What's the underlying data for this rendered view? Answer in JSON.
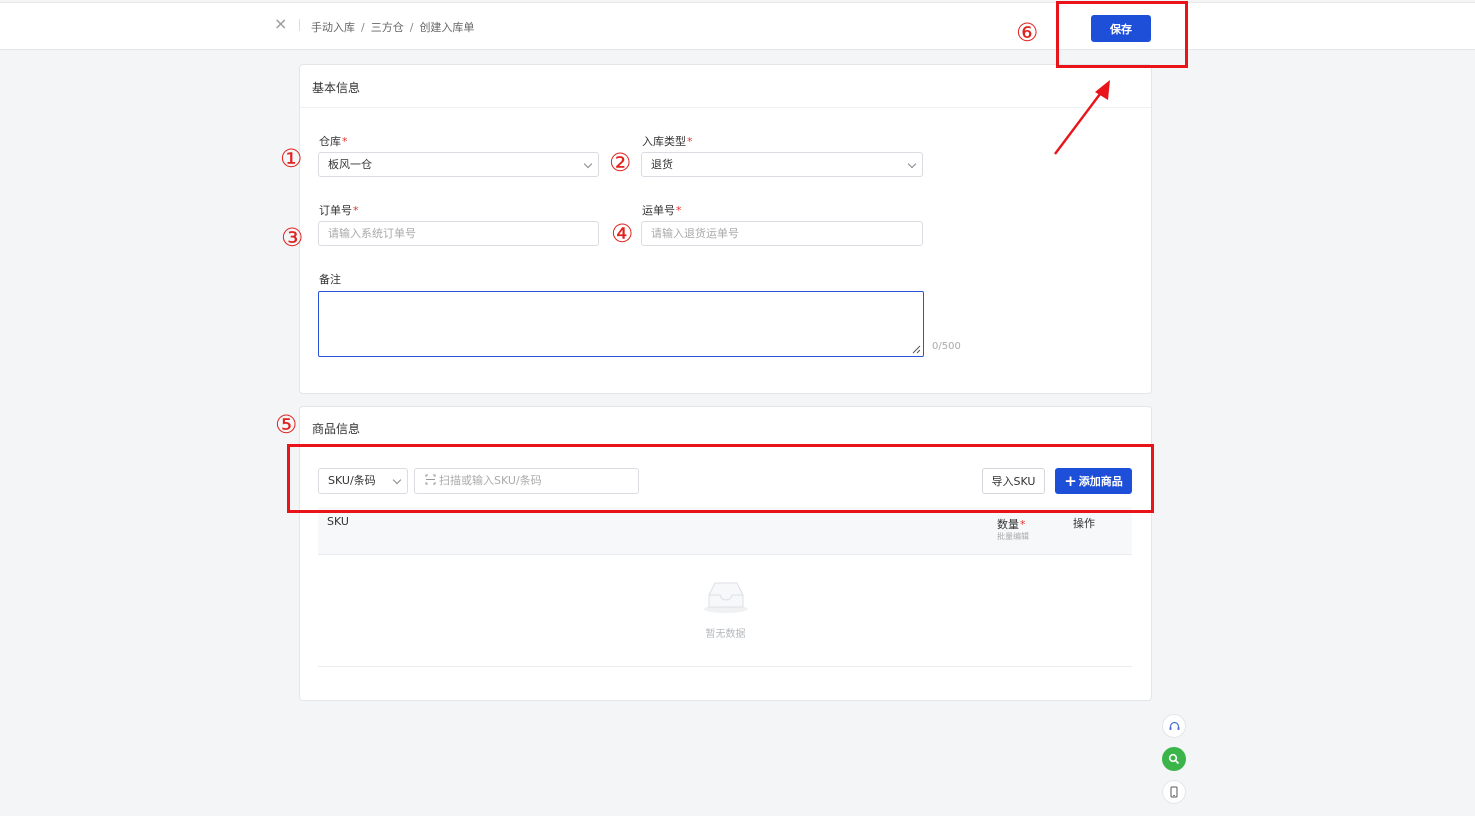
{
  "header": {
    "breadcrumb": [
      "手动入库",
      "三方仓",
      "创建入库单"
    ],
    "breadcrumb_sep": "/",
    "save_label": "保存"
  },
  "basic_info": {
    "title": "基本信息",
    "warehouse": {
      "label": "仓库",
      "value": "板风一仓"
    },
    "inbound_type": {
      "label": "入库类型",
      "value": "退货"
    },
    "order_no": {
      "label": "订单号",
      "placeholder": "请输入系统订单号"
    },
    "waybill_no": {
      "label": "运单号",
      "placeholder": "请输入退货运单号"
    },
    "remark": {
      "label": "备注",
      "counter": "0/500"
    },
    "required_mark": "*"
  },
  "product_info": {
    "title": "商品信息",
    "search_type": "SKU/条码",
    "search_placeholder": "扫描或输入SKU/条码",
    "import_label": "导入SKU",
    "add_label": "添加商品",
    "add_symbol": "+",
    "table": {
      "col_sku": "SKU",
      "col_qty": "数量",
      "col_qty_sub": "批量编辑",
      "col_action": "操作"
    },
    "empty_text": "暂无数据"
  },
  "annotations": [
    "①",
    "②",
    "③",
    "④",
    "⑤",
    "⑥"
  ],
  "colors": {
    "primary": "#1e4fd8",
    "annotation": "#e8141a",
    "required": "#e5302d"
  },
  "icons": [
    "close-icon",
    "chevron-down-icon",
    "scan-icon",
    "plus-icon",
    "inbox-icon",
    "headset-icon",
    "search-icon",
    "mobile-icon"
  ]
}
